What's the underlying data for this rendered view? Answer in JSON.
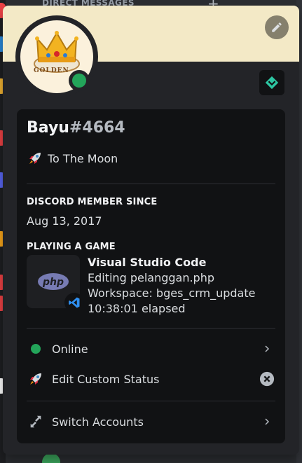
{
  "background": {
    "dm_label": "DIRECT MESSAGES",
    "add_icon": "plus-icon"
  },
  "profile": {
    "banner_color": "#f3e9c6",
    "avatar_text": "GOLDEN",
    "status_color": "#23a55a",
    "username": "Bayu",
    "discriminator": "#4664",
    "custom_status_emoji": "rocket-icon",
    "custom_status": "To The Moon"
  },
  "sections": {
    "member_since_title": "DISCORD MEMBER SINCE",
    "member_since_date": "Aug 13, 2017",
    "playing_title": "PLAYING A GAME"
  },
  "game": {
    "large_icon_text": "php",
    "small_icon": "vscode-icon",
    "name": "Visual Studio Code",
    "details": "Editing pelanggan.php",
    "state": "Workspace: bges_crm_update",
    "elapsed": "10:38:01 elapsed"
  },
  "menu": {
    "online_label": "Online",
    "edit_status_label": "Edit Custom Status",
    "switch_accounts_label": "Switch Accounts"
  },
  "colors": {
    "online": "#23a55a",
    "badge_accent": "#2dc7a3"
  }
}
